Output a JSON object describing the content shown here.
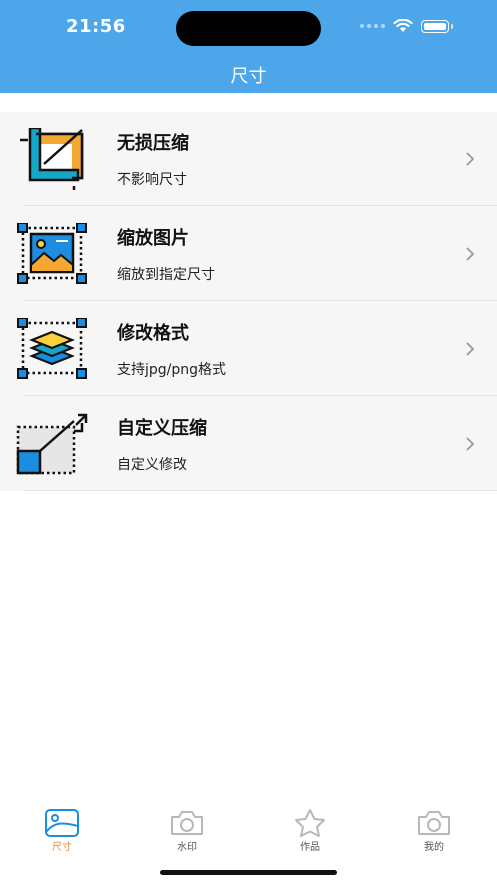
{
  "status": {
    "time": "21:56"
  },
  "header": {
    "title": "尺寸"
  },
  "rows": [
    {
      "title": "无损压缩",
      "subtitle": "不影响尺寸",
      "icon": "crop-icon"
    },
    {
      "title": "缩放图片",
      "subtitle": "缩放到指定尺寸",
      "icon": "image-resize-icon"
    },
    {
      "title": "修改格式",
      "subtitle": "支持jpg/png格式",
      "icon": "layers-icon"
    },
    {
      "title": "自定义压缩",
      "subtitle": "自定义修改",
      "icon": "expand-icon"
    }
  ],
  "tabs": [
    {
      "label": "尺寸",
      "icon": "image-icon",
      "active": true
    },
    {
      "label": "水印",
      "icon": "camera-icon",
      "active": false
    },
    {
      "label": "作品",
      "icon": "star-icon",
      "active": false
    },
    {
      "label": "我的",
      "icon": "camera-icon",
      "active": false
    }
  ],
  "colors": {
    "header_bg": "#4EA6EA",
    "list_bg": "#F6F6F6",
    "active_tab": "#E8873A",
    "icon_blue": "#1C8DE0",
    "icon_orange": "#F4A731",
    "icon_yellow": "#F7D23E",
    "icon_teal": "#15A7C8"
  }
}
